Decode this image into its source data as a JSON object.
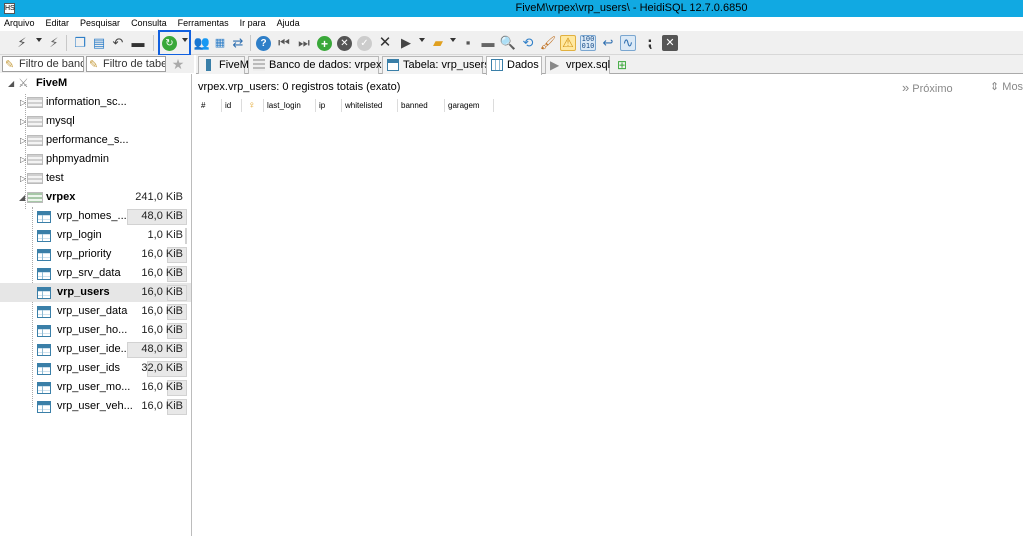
{
  "window": {
    "title": "FiveM\\vrpex\\vrp_users\\ - HeidiSQL 12.7.0.6850",
    "app_icon": "HS"
  },
  "menu": [
    "Arquivo",
    "Editar",
    "Pesquisar",
    "Consulta",
    "Ferramentas",
    "Ir para",
    "Ajuda"
  ],
  "filters": {
    "database": "Filtro de banco",
    "table": "Filtro de tabela"
  },
  "tabs": [
    {
      "label": "FiveM",
      "icon": "server-icon"
    },
    {
      "label": "Banco de dados: vrpex",
      "icon": "database-icon"
    },
    {
      "label": "Tabela: vrp_users",
      "icon": "table-icon"
    },
    {
      "label": "Dados",
      "icon": "grid-icon",
      "active": true
    },
    {
      "label": "vrpex.sql",
      "icon": "query-icon"
    }
  ],
  "tree": {
    "root": "FiveM",
    "databases": [
      "information_sc...",
      "mysql",
      "performance_s...",
      "phpmyadmin",
      "test"
    ],
    "open_db": {
      "name": "vrpex",
      "size": "241,0 KiB"
    },
    "tables": [
      {
        "name": "vrp_homes_...",
        "size": "48,0 KiB",
        "fill": 0.36
      },
      {
        "name": "vrp_login",
        "size": "1,0 KiB",
        "fill": 0.01
      },
      {
        "name": "vrp_priority",
        "size": "16,0 KiB",
        "fill": 0.12
      },
      {
        "name": "vrp_srv_data",
        "size": "16,0 KiB",
        "fill": 0.12
      },
      {
        "name": "vrp_users",
        "size": "16,0 KiB",
        "fill": 0.12,
        "selected": true
      },
      {
        "name": "vrp_user_data",
        "size": "16,0 KiB",
        "fill": 0.12
      },
      {
        "name": "vrp_user_ho...",
        "size": "16,0 KiB",
        "fill": 0.12
      },
      {
        "name": "vrp_user_ide...",
        "size": "48,0 KiB",
        "fill": 0.36
      },
      {
        "name": "vrp_user_ids",
        "size": "32,0 KiB",
        "fill": 0.24
      },
      {
        "name": "vrp_user_mo...",
        "size": "16,0 KiB",
        "fill": 0.12
      },
      {
        "name": "vrp_user_veh...",
        "size": "16,0 KiB",
        "fill": 0.12
      }
    ]
  },
  "data": {
    "info": "vrpex.vrp_users: 0 registros totais (exato)",
    "next_label": "Próximo",
    "more_label": "Mos",
    "columns": [
      "#",
      "id",
      "",
      "last_login",
      "ip",
      "whitelisted",
      "banned",
      "garagem"
    ]
  },
  "colors": {
    "titlebar": "#11a9e2",
    "highlight": "#1060e0"
  }
}
